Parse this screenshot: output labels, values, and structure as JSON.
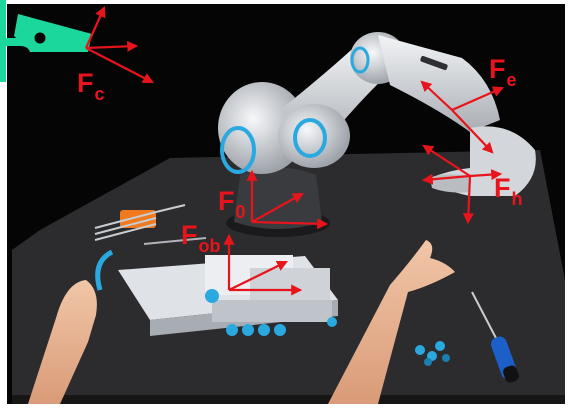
{
  "colors": {
    "frame": "#e8141b",
    "camera": "#1bd79b",
    "background": "#050505",
    "table": "#2c2c2f",
    "robot": "#d9dce0",
    "accent": "#2aa9e0"
  },
  "labels": {
    "fc": {
      "main": "F",
      "sub": "c"
    },
    "fe": {
      "main": "F",
      "sub": "e"
    },
    "fh": {
      "main": "F",
      "sub": "h"
    },
    "f0": {
      "main": "F",
      "sub": "0"
    },
    "fob": {
      "main": "F",
      "sub": "ob"
    }
  },
  "icons": {
    "camera": "security-camera-icon"
  }
}
